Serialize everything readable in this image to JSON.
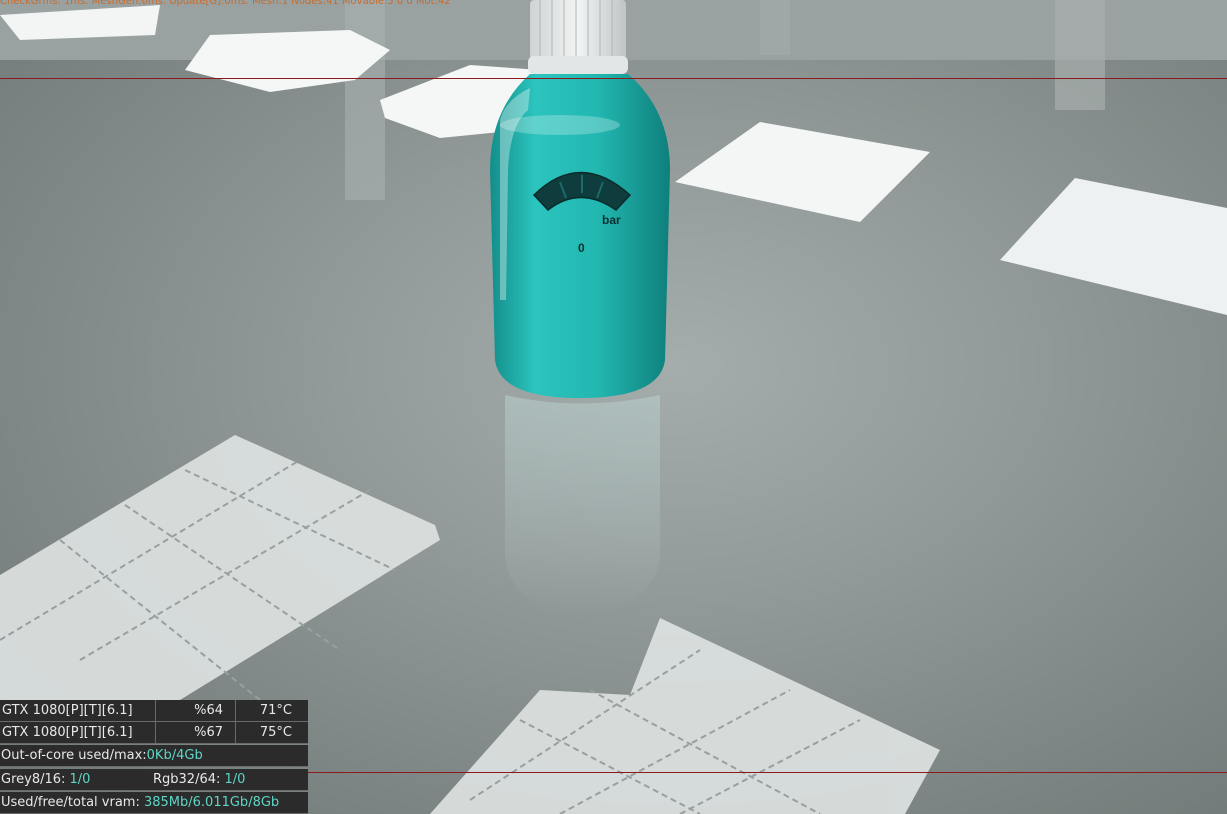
{
  "viewport": {
    "stats_line": "CheckGrms: 1ms. MeshGen:0ms. Update[G]:0ms. Mesh:1 Nodes:41 Movable:5 0 0 Mot:42",
    "bottle_label_unit": "bar",
    "bottle_label_mark": "0",
    "colors": {
      "bottle": "#1fb5b0",
      "floor": "#949c9b",
      "guide_line": "#8b1a1a",
      "stats_text": "#c86a2a",
      "hud_value": "#5fd6c6"
    }
  },
  "hud": {
    "gpus": [
      {
        "name": "GTX 1080[P][T][6.1]",
        "load": "%64",
        "temp": "71°C"
      },
      {
        "name": "GTX 1080[P][T][6.1]",
        "load": "%67",
        "temp": "75°C"
      }
    ],
    "out_of_core": {
      "label": "Out-of-core used/max:",
      "used": "0Kb",
      "sep": "/",
      "max": "4Gb"
    },
    "textures": {
      "grey_label": "Grey8/16: ",
      "grey_value": "1/0",
      "rgb_label": "Rgb32/64: ",
      "rgb_value": "1/0"
    },
    "vram": {
      "label": "Used/free/total vram: ",
      "used": "385Mb",
      "sep1": "/",
      "free": "6.011Gb",
      "sep2": "/",
      "total": "8Gb"
    }
  }
}
